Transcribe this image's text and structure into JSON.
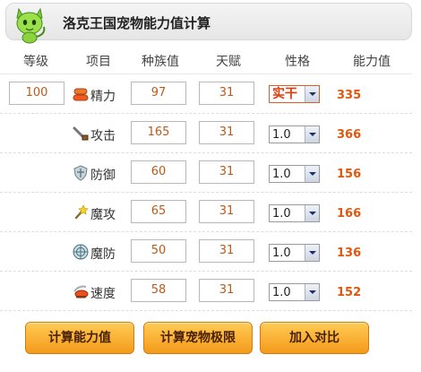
{
  "header": {
    "title": "洛克王国宠物能力值计算"
  },
  "columns": {
    "level": "等级",
    "item": "项目",
    "race": "种族值",
    "talent": "天赋",
    "nature": "性格",
    "ability": "能力值"
  },
  "level": "100",
  "stats": [
    {
      "label": "精力",
      "icon": "stamina-icon",
      "race": "97",
      "talent": "31",
      "nature": "实干",
      "ability": "335"
    },
    {
      "label": "攻击",
      "icon": "attack-icon",
      "race": "165",
      "talent": "31",
      "nature": "1.0",
      "ability": "366"
    },
    {
      "label": "防御",
      "icon": "defense-icon",
      "race": "60",
      "talent": "31",
      "nature": "1.0",
      "ability": "156"
    },
    {
      "label": "魔攻",
      "icon": "magic-attack-icon",
      "race": "65",
      "talent": "31",
      "nature": "1.0",
      "ability": "166"
    },
    {
      "label": "魔防",
      "icon": "magic-defense-icon",
      "race": "50",
      "talent": "31",
      "nature": "1.0",
      "ability": "136"
    },
    {
      "label": "速度",
      "icon": "speed-icon",
      "race": "58",
      "talent": "31",
      "nature": "1.0",
      "ability": "152"
    }
  ],
  "buttons": {
    "calc": "计算能力值",
    "limit": "计算宠物极限",
    "compare": "加入对比"
  },
  "colors": {
    "accent": "#e0570e",
    "button": "#f7a82a"
  }
}
